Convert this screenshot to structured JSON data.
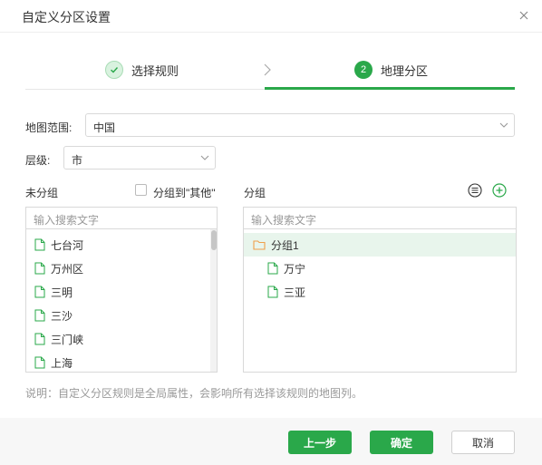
{
  "dialog": {
    "title": "自定义分区设置"
  },
  "steps": [
    {
      "label": "选择规则",
      "state": "done"
    },
    {
      "number": "2",
      "label": "地理分区",
      "state": "active"
    }
  ],
  "form": {
    "map_range_label": "地图范围:",
    "map_range_value": "中国",
    "level_label": "层级:",
    "level_value": "市"
  },
  "ungrouped": {
    "title": "未分组",
    "checkbox_label": "分组到\"其他\"",
    "search_placeholder": "输入搜索文字",
    "items": [
      "七台河",
      "万州区",
      "三明",
      "三沙",
      "三门峡",
      "上海"
    ]
  },
  "grouped": {
    "title": "分组",
    "search_placeholder": "输入搜索文字",
    "groups": [
      {
        "name": "分组1",
        "items": [
          "万宁",
          "三亚"
        ]
      }
    ]
  },
  "note": "说明：自定义分区规则是全局属性，会影响所有选择该规则的地图列。",
  "buttons": {
    "prev": "上一步",
    "ok": "确定",
    "cancel": "取消"
  },
  "colors": {
    "accent": "#2aa84a",
    "folder": "#f0a04b",
    "selected_row": "#e8f5ec"
  }
}
